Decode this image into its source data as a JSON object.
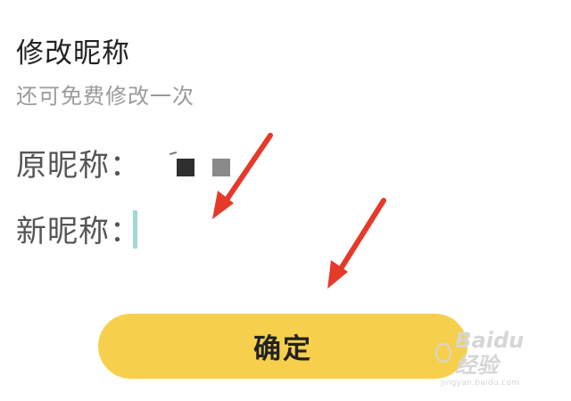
{
  "dialog": {
    "title": "修改昵称",
    "subtitle": "还可免费修改一次",
    "old_label": "原昵称：",
    "new_label": "新昵称：",
    "new_value": "",
    "confirm_label": "确定"
  },
  "annotations": {
    "arrow_color": "#e5392a",
    "arrow_count": 2
  },
  "watermark": {
    "brand": "Baidu 经验",
    "url": "jingyan.baidu.com"
  },
  "colors": {
    "button": "#f6d04d",
    "title": "#222222",
    "subtitle": "#9a9a9a",
    "label": "#555555",
    "cursor": "#9fd9cf"
  }
}
